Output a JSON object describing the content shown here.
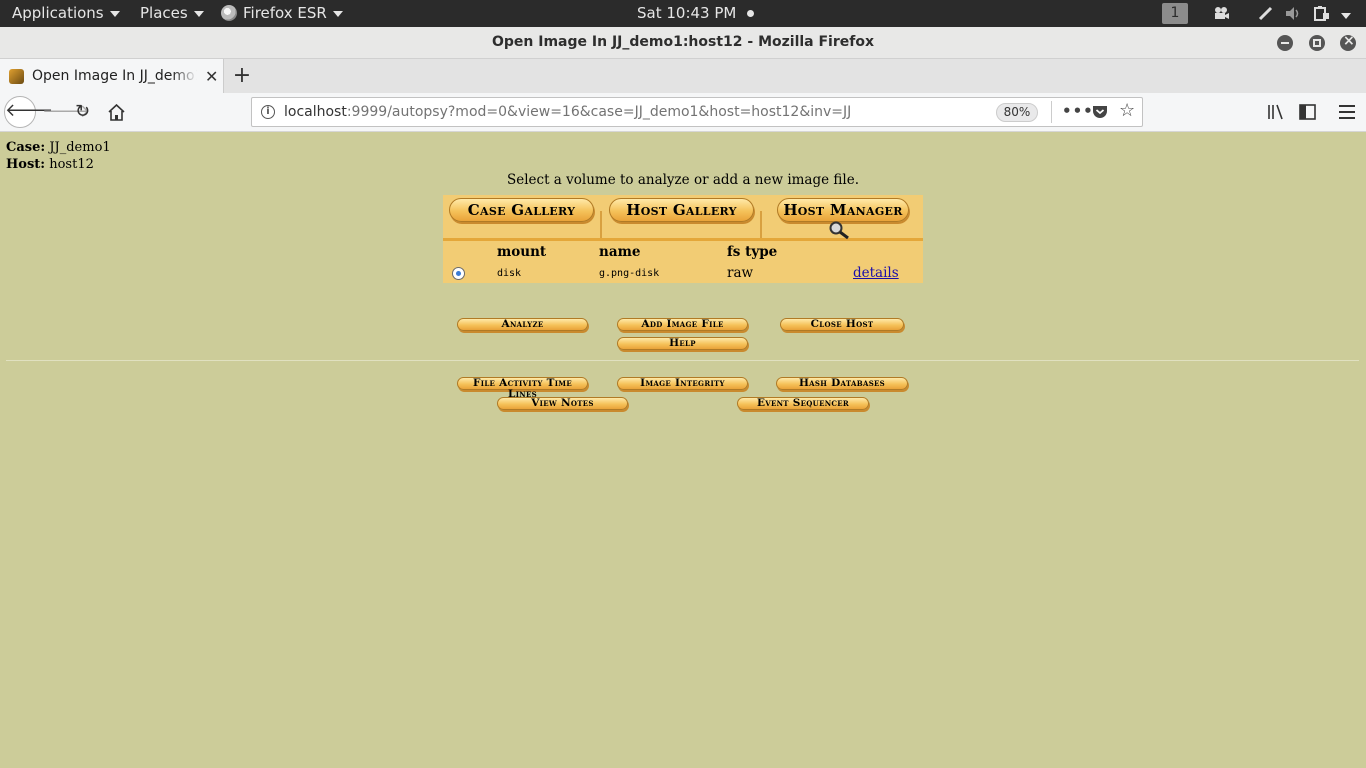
{
  "topbar": {
    "applications": "Applications",
    "places": "Places",
    "firefox_app": "Firefox ESR",
    "clock": "Sat 10:43 PM",
    "workspace": "1"
  },
  "window": {
    "title": "Open Image In JJ_demo1:host12 - Mozilla Firefox"
  },
  "tab": {
    "label": "Open Image In JJ_demo1:host12",
    "new_tab": "+"
  },
  "nav": {
    "url_host": "localhost",
    "url_path": ":9999/autopsy?mod=0&view=16&case=JJ_demo1&host=host12&inv=JJ",
    "zoom": "80%"
  },
  "page": {
    "case_label": "Case:",
    "case_value": "JJ_demo1",
    "host_label": "Host:",
    "host_value": "host12",
    "instruction": "Select a volume to analyze or add a new image file.",
    "gallery_buttons": {
      "case_gallery": "Case Gallery",
      "host_gallery": "Host Gallery",
      "host_manager": "Host Manager"
    },
    "table": {
      "headers": [
        "mount",
        "name",
        "fs type"
      ],
      "rows": [
        {
          "mount": "disk",
          "name": "g.png-disk",
          "fs_type": "raw",
          "link": "details"
        }
      ]
    },
    "actions": {
      "analyze": "Analyze",
      "add_image_file": "Add Image File",
      "close_host": "Close Host",
      "help": "Help"
    },
    "tools": {
      "file_activity": "File Activity Time Lines",
      "image_integrity": "Image Integrity",
      "hash_databases": "Hash Databases",
      "view_notes": "View Notes",
      "event_sequencer": "Event Sequencer"
    }
  }
}
